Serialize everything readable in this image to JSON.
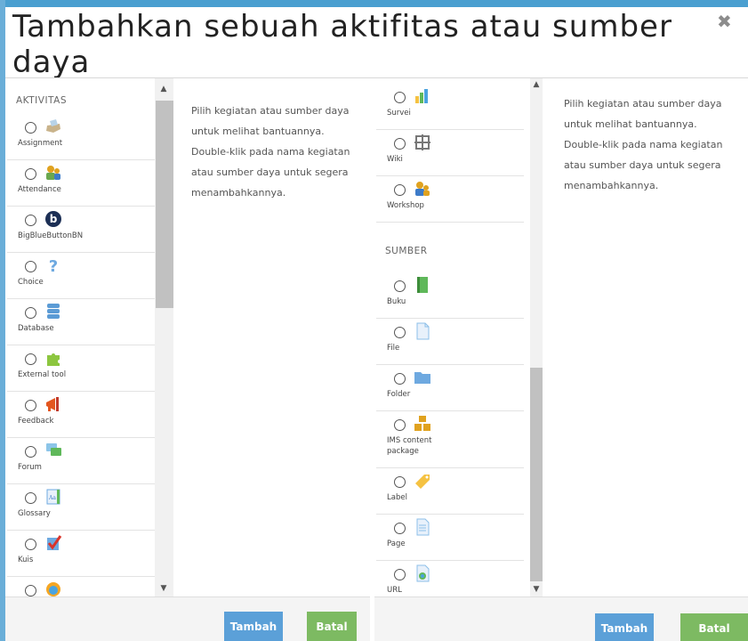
{
  "dialog": {
    "title": "Tambahkan sebuah aktifitas atau sumber daya",
    "close_icon": "close-icon"
  },
  "help_text": {
    "line1": "Pilih kegiatan atau sumber daya untuk melihat bantuannya.",
    "line2": "Double-klik pada nama kegiatan atau sumber daya untuk segera menambahkannya."
  },
  "sections": {
    "activities": "AKTIVITAS",
    "resources": "SUMBER"
  },
  "activities": [
    {
      "label": "Assignment",
      "icon": "assignment-icon"
    },
    {
      "label": "Attendance",
      "icon": "attendance-icon"
    },
    {
      "label": "BigBlueButtonBN",
      "icon": "bigbluebutton-icon"
    },
    {
      "label": "Choice",
      "icon": "choice-icon"
    },
    {
      "label": "Database",
      "icon": "database-icon"
    },
    {
      "label": "External tool",
      "icon": "puzzle-icon"
    },
    {
      "label": "Feedback",
      "icon": "megaphone-icon"
    },
    {
      "label": "Forum",
      "icon": "forum-icon"
    },
    {
      "label": "Glossary",
      "icon": "glossary-icon"
    },
    {
      "label": "Kuis",
      "icon": "quiz-icon"
    },
    {
      "label": "",
      "icon": "chat-icon"
    }
  ],
  "right_activities": [
    {
      "label": "Survei",
      "icon": "survey-icon"
    },
    {
      "label": "Wiki",
      "icon": "wiki-icon"
    },
    {
      "label": "Workshop",
      "icon": "workshop-icon"
    }
  ],
  "resources": [
    {
      "label": "Buku",
      "icon": "book-icon"
    },
    {
      "label": "File",
      "icon": "file-icon"
    },
    {
      "label": "Folder",
      "icon": "folder-icon"
    },
    {
      "label": "IMS content",
      "label2": "package",
      "icon": "ims-package-icon"
    },
    {
      "label": "Label",
      "icon": "label-icon"
    },
    {
      "label": "Page",
      "icon": "page-icon"
    },
    {
      "label": "URL",
      "icon": "url-icon"
    }
  ],
  "buttons": {
    "add": "Tambah",
    "cancel": "Batal"
  },
  "colors": {
    "accent": "#5ba0d8",
    "cancel": "#7dba62",
    "header": "#4a9fd0"
  }
}
